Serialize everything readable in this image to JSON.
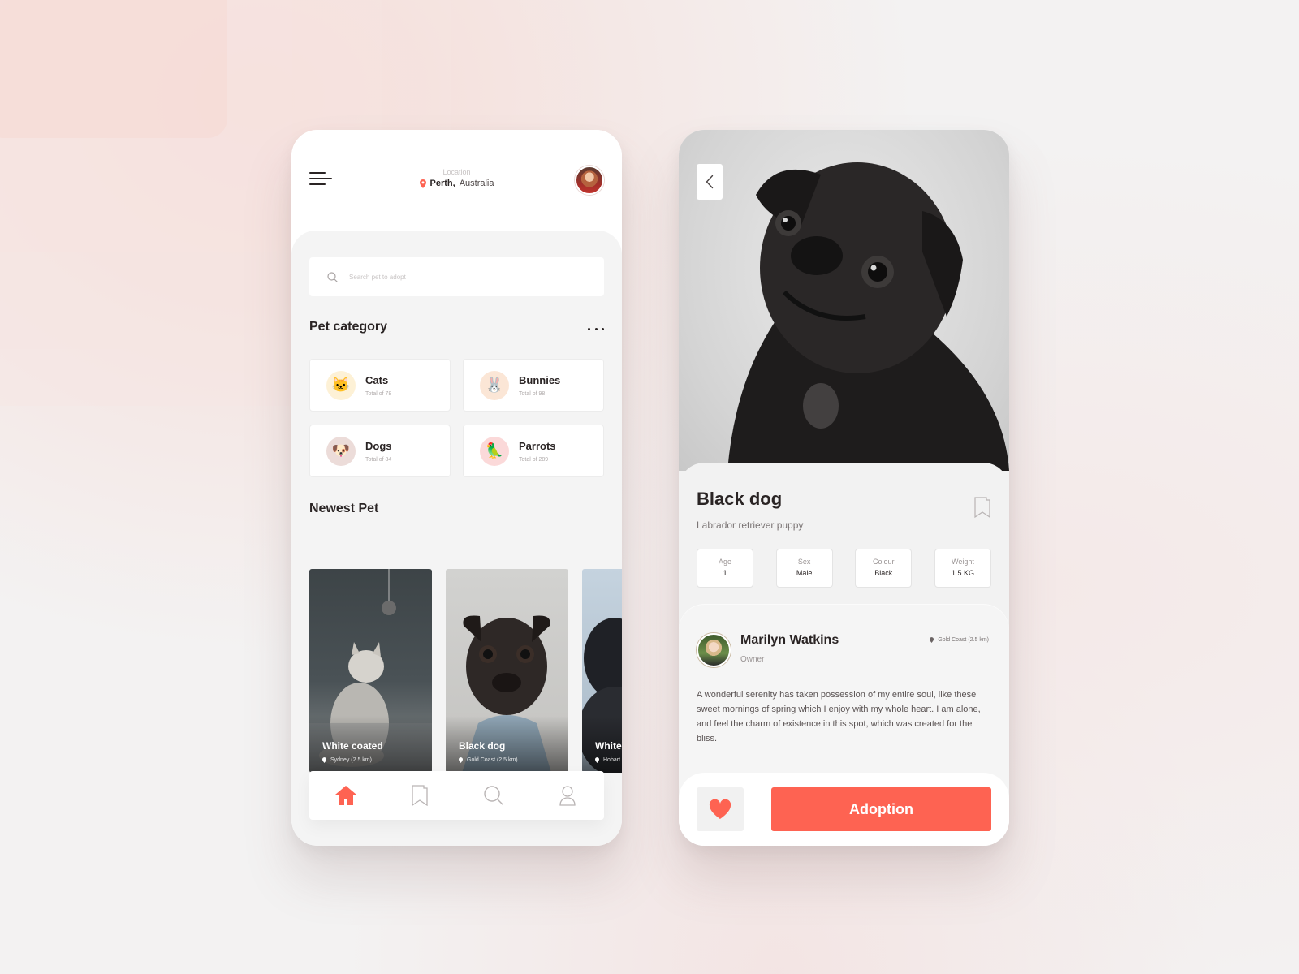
{
  "colors": {
    "accent": "#fe6352",
    "text_primary": "#2a2424",
    "text_muted": "#9a9494",
    "panel_bg": "#f4f4f4",
    "page_bg": "#f3f2f2"
  },
  "home": {
    "menu_icon": "hamburger-menu-icon",
    "location": {
      "label": "Location",
      "city": "Perth,",
      "country": "Australia",
      "icon": "location-pin-icon"
    },
    "search": {
      "placeholder": "Search pet to adopt",
      "value": "",
      "icon": "search-icon"
    },
    "pet_category": {
      "title": "Pet category",
      "more_icon": "more-horizontal-icon",
      "items": [
        {
          "name": "Cats",
          "total": "Total of 78",
          "emoji": "🐱",
          "icon_bg": "#fdf1d6"
        },
        {
          "name": "Bunnies",
          "total": "Total of 98",
          "emoji": "🐰",
          "icon_bg": "#fbe6d6"
        },
        {
          "name": "Dogs",
          "total": "Total of 84",
          "emoji": "🐶",
          "icon_bg": "#ecdcd9"
        },
        {
          "name": "Parrots",
          "total": "Total of 289",
          "emoji": "🦜",
          "icon_bg": "#fbd9d9"
        }
      ]
    },
    "newest_pet": {
      "title": "Newest Pet",
      "items": [
        {
          "name": "White coated",
          "location": "Sydney (2.5 km)"
        },
        {
          "name": "Black dog",
          "location": "Gold Coast (2.5 km)"
        },
        {
          "name": "White",
          "location": "Hobart"
        }
      ]
    },
    "tabbar": {
      "items": [
        {
          "name": "home",
          "icon": "home-icon",
          "active": true
        },
        {
          "name": "saved",
          "icon": "bookmark-icon",
          "active": false
        },
        {
          "name": "search",
          "icon": "search-icon",
          "active": false
        },
        {
          "name": "profile",
          "icon": "user-icon",
          "active": false
        }
      ]
    }
  },
  "detail": {
    "back_icon": "chevron-left-icon",
    "title": "Black dog",
    "subtitle": "Labrador retriever puppy",
    "bookmark_icon": "bookmark-icon",
    "attributes": [
      {
        "label": "Age",
        "value": "1"
      },
      {
        "label": "Sex",
        "value": "Male"
      },
      {
        "label": "Colour",
        "value": "Black"
      },
      {
        "label": "Weight",
        "value": "1.5 KG"
      }
    ],
    "owner": {
      "name": "Marilyn Watkins",
      "role": "Owner",
      "location": "Gold Coast (2.5 km)",
      "bio": "A wonderful serenity has taken possession of my entire soul, like these sweet mornings of spring which I enjoy with my whole heart. I am alone, and feel the charm of existence in this spot, which was created for the bliss."
    },
    "actions": {
      "like_icon": "heart-icon",
      "adopt_label": "Adoption"
    }
  }
}
